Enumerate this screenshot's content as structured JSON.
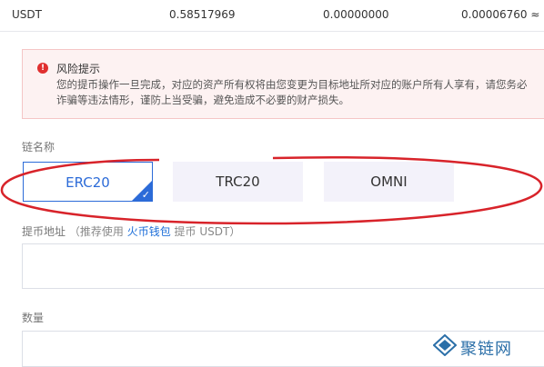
{
  "balance": {
    "currency": "USDT",
    "available": "0.58517969",
    "frozen": "0.00000000",
    "btc_value": "0.00006760 ≈"
  },
  "alert": {
    "icon": "error-icon",
    "title": "风险提示",
    "line1": "您的提币操作一旦完成，对应的资产所有权将由您变更为目标地址所对应的账户所有人享有，请您务必",
    "line2": "诈骗等违法情形，谨防上当受骗，避免造成不必要的财产损失。"
  },
  "chain": {
    "label": "链名称",
    "options": [
      "ERC20",
      "TRC20",
      "OMNI"
    ],
    "selected": "ERC20"
  },
  "address": {
    "label": "提币地址",
    "hint_prefix": "（推荐使用",
    "wallet_link": "火币钱包",
    "hint_suffix": "提币 USDT）"
  },
  "quantity": {
    "label": "数量"
  },
  "annotation_color": "#d8232a",
  "watermark": {
    "text": "聚链网"
  }
}
